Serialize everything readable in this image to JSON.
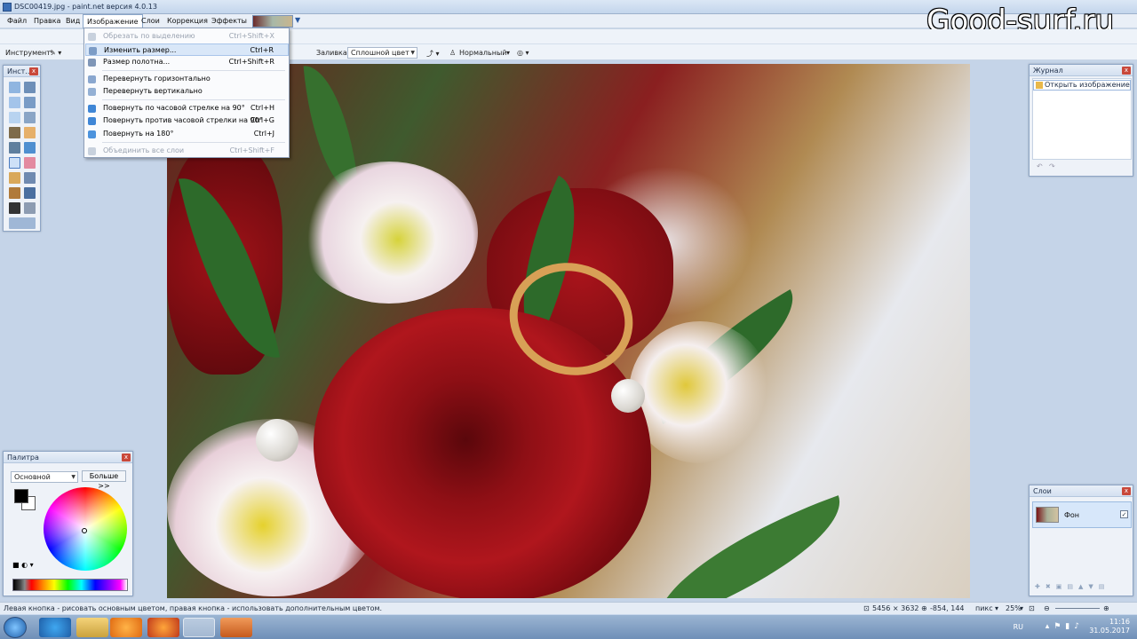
{
  "window": {
    "title": "DSC00419.jpg - paint.net версия 4.0.13",
    "watermark": "Good-surf.ru"
  },
  "menu": {
    "items": [
      {
        "label": "Файл"
      },
      {
        "label": "Правка"
      },
      {
        "label": "Вид"
      },
      {
        "label": "Изображение"
      },
      {
        "label": "Слои"
      },
      {
        "label": "Коррекция"
      },
      {
        "label": "Эффекты"
      }
    ]
  },
  "toolbar": {
    "instrument_label": "Инструмент:",
    "fill_label": "Заливка:",
    "fill_value": "Сплошной цвет",
    "blend_value": "Нормальный"
  },
  "image_menu": {
    "items": [
      {
        "label": "Обрезать по выделению",
        "shortcut": "Ctrl+Shift+X",
        "disabled": true
      },
      {
        "label": "Изменить размер...",
        "shortcut": "Ctrl+R",
        "highlighted": true
      },
      {
        "label": "Размер полотна...",
        "shortcut": "Ctrl+Shift+R"
      },
      {
        "label": "Перевернуть горизонтально",
        "shortcut": ""
      },
      {
        "label": "Перевернуть вертикально",
        "shortcut": ""
      },
      {
        "label": "Повернуть по часовой стрелке на 90°",
        "shortcut": "Ctrl+H"
      },
      {
        "label": "Повернуть против часовой стрелки на 90°",
        "shortcut": "Ctrl+G"
      },
      {
        "label": "Повернуть на 180°",
        "shortcut": "Ctrl+J"
      },
      {
        "label": "Объединить все слои",
        "shortcut": "Ctrl+Shift+F",
        "disabled": true
      }
    ]
  },
  "tools_panel": {
    "title": "Инст..."
  },
  "history_panel": {
    "title": "Журнал",
    "items": [
      {
        "label": "Открыть изображение"
      }
    ]
  },
  "layers_panel": {
    "title": "Слои",
    "layers": [
      {
        "name": "Фон",
        "visible": true
      }
    ]
  },
  "palette_panel": {
    "title": "Палитра",
    "mode": "Основной",
    "more_button": "Больше >>"
  },
  "status": {
    "hint": "Левая кнопка - рисовать основным цветом, правая кнопка - использовать дополнительным цветом.",
    "image_size": "5456 × 3632",
    "cursor": "-854, 144",
    "units": "пикс",
    "zoom": "25%"
  },
  "taskbar": {
    "lang": "RU",
    "time": "11:16",
    "date": "31.05.2017"
  },
  "colors": {
    "primary": "#000000",
    "secondary": "#ffffff",
    "menu_highlight": "#d9e7f8"
  }
}
